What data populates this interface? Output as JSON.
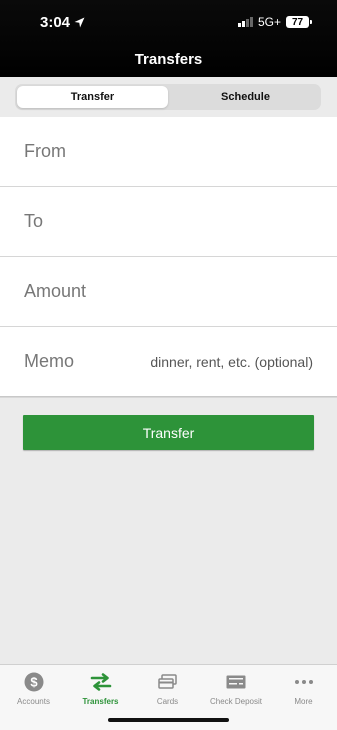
{
  "status": {
    "time": "3:04",
    "network": "5G+",
    "battery": "77"
  },
  "header": {
    "title": "Transfers"
  },
  "segments": [
    {
      "label": "Transfer",
      "active": true
    },
    {
      "label": "Schedule",
      "active": false
    }
  ],
  "form": {
    "from": {
      "label": "From"
    },
    "to": {
      "label": "To"
    },
    "amount": {
      "label": "Amount"
    },
    "memo": {
      "label": "Memo",
      "placeholder": "dinner, rent, etc. (optional)"
    }
  },
  "actions": {
    "transfer_label": "Transfer"
  },
  "tabs": [
    {
      "label": "Accounts",
      "icon": "dollar-circle-icon"
    },
    {
      "label": "Transfers",
      "icon": "transfer-arrows-icon",
      "active": true
    },
    {
      "label": "Cards",
      "icon": "cards-icon"
    },
    {
      "label": "Check Deposit",
      "icon": "check-icon"
    },
    {
      "label": "More",
      "icon": "more-dots-icon"
    }
  ],
  "colors": {
    "accent": "#2d9339",
    "header_bg": "#000000",
    "background": "#ebebeb"
  }
}
